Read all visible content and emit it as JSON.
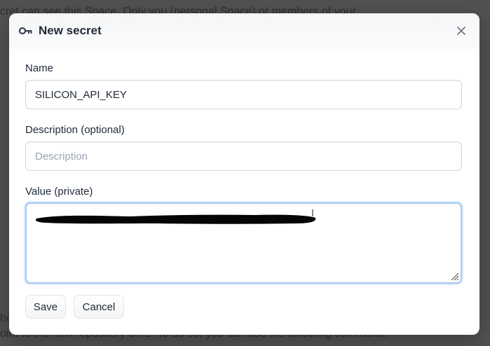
{
  "background": {
    "top_text": "cret can see this Space. Only you (personal Space) or members of your",
    "bottom_text_1": "he",
    "bottom_text_2": "oint to the new repository URL. To do so, you can use the following command:"
  },
  "dialog": {
    "title": "New secret",
    "title_icon": "key-icon",
    "close_icon": "close-icon",
    "name": {
      "label": "Name",
      "value": "SILICON_API_KEY"
    },
    "description": {
      "label": "Description (optional)",
      "value": "",
      "placeholder": "Description"
    },
    "value": {
      "label": "Value (private)"
    },
    "save_label": "Save",
    "cancel_label": "Cancel"
  },
  "colors": {
    "backdrop": "#515151",
    "focus_ring": "#a9c8ef",
    "text": "#1f2937",
    "placeholder": "#9ca3af"
  }
}
